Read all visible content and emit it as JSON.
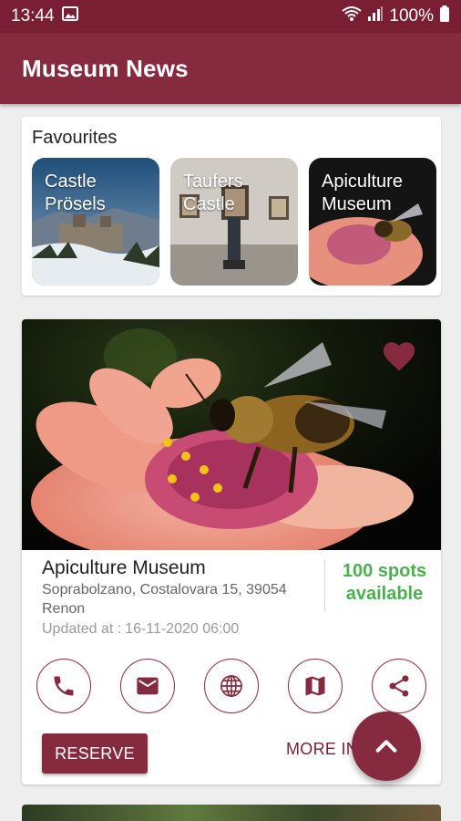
{
  "status_bar": {
    "time": "13:44",
    "battery": "100%"
  },
  "app_bar": {
    "title": "Museum News"
  },
  "favourites": {
    "title": "Favourites",
    "items": [
      {
        "label": "Castle Prösels"
      },
      {
        "label": "Taufers Castle"
      },
      {
        "label": "Apiculture Museum"
      }
    ]
  },
  "museum": {
    "name": "Apiculture Museum",
    "address": "Soprabolzano, Costalovara 15, 39054 Renon",
    "updated_label": "Updated at :",
    "updated_value": "16-11-2020 06:00",
    "spots": "100 spots available",
    "favourited": true,
    "actions": [
      "phone-icon",
      "mail-icon",
      "globe-icon",
      "map-icon",
      "share-icon"
    ],
    "reserve_label": "RESERVE",
    "more_info_label": "MORE INFO"
  },
  "colors": {
    "primary": "#862a40",
    "status_bar": "#7a1f33",
    "available": "#4caf50"
  }
}
